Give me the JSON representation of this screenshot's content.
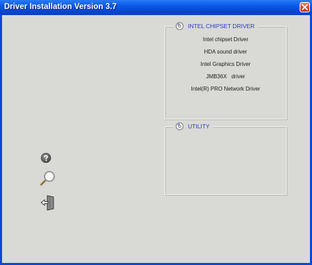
{
  "window": {
    "title": "Driver Installation Version 3.7"
  },
  "chipset_group": {
    "title": "INTEL CHIPSET DRIVER",
    "items": [
      "Intel chipset Driver",
      "HDA sound driver",
      "Intel Graphics Driver",
      "JMB36X   driver",
      "Intel(R) PRO Network Driver"
    ]
  },
  "utility_group": {
    "title": "UTILITY"
  },
  "side_icons": [
    "help-icon",
    "search-icon",
    "exit-icon"
  ]
}
